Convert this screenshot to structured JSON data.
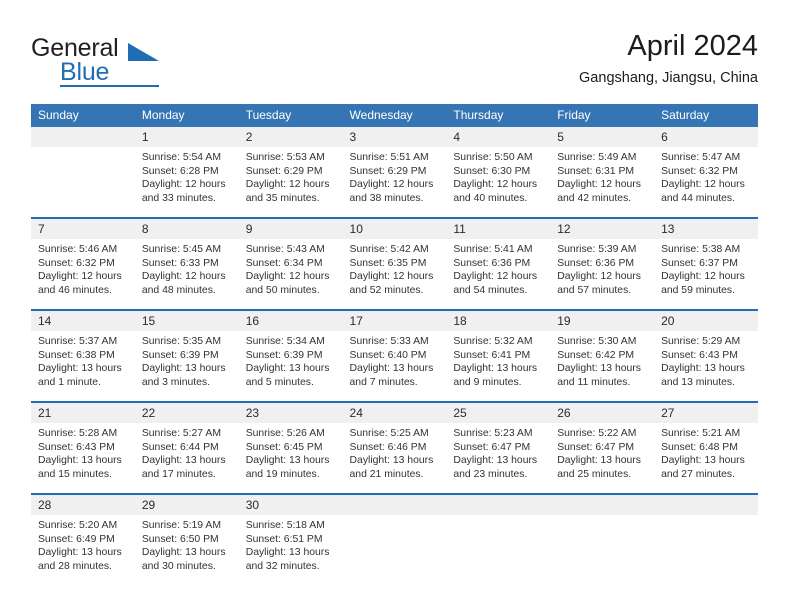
{
  "brand": {
    "name_part1": "General",
    "name_part2": "Blue",
    "logo_icon": "triangle-flag-icon"
  },
  "header": {
    "month_title": "April 2024",
    "location": "Gangshang, Jiangsu, China"
  },
  "colors": {
    "header_blue": "#3575b4",
    "rule_blue": "#1f6eb5",
    "daynum_band": "#f0f0f0",
    "text": "#2b2b2b"
  },
  "calendar": {
    "weekday_headers": [
      "Sunday",
      "Monday",
      "Tuesday",
      "Wednesday",
      "Thursday",
      "Friday",
      "Saturday"
    ],
    "weeks": [
      [
        {
          "day": "",
          "lines": []
        },
        {
          "day": "1",
          "lines": [
            "Sunrise: 5:54 AM",
            "Sunset: 6:28 PM",
            "Daylight: 12 hours",
            "and 33 minutes."
          ]
        },
        {
          "day": "2",
          "lines": [
            "Sunrise: 5:53 AM",
            "Sunset: 6:29 PM",
            "Daylight: 12 hours",
            "and 35 minutes."
          ]
        },
        {
          "day": "3",
          "lines": [
            "Sunrise: 5:51 AM",
            "Sunset: 6:29 PM",
            "Daylight: 12 hours",
            "and 38 minutes."
          ]
        },
        {
          "day": "4",
          "lines": [
            "Sunrise: 5:50 AM",
            "Sunset: 6:30 PM",
            "Daylight: 12 hours",
            "and 40 minutes."
          ]
        },
        {
          "day": "5",
          "lines": [
            "Sunrise: 5:49 AM",
            "Sunset: 6:31 PM",
            "Daylight: 12 hours",
            "and 42 minutes."
          ]
        },
        {
          "day": "6",
          "lines": [
            "Sunrise: 5:47 AM",
            "Sunset: 6:32 PM",
            "Daylight: 12 hours",
            "and 44 minutes."
          ]
        }
      ],
      [
        {
          "day": "7",
          "lines": [
            "Sunrise: 5:46 AM",
            "Sunset: 6:32 PM",
            "Daylight: 12 hours",
            "and 46 minutes."
          ]
        },
        {
          "day": "8",
          "lines": [
            "Sunrise: 5:45 AM",
            "Sunset: 6:33 PM",
            "Daylight: 12 hours",
            "and 48 minutes."
          ]
        },
        {
          "day": "9",
          "lines": [
            "Sunrise: 5:43 AM",
            "Sunset: 6:34 PM",
            "Daylight: 12 hours",
            "and 50 minutes."
          ]
        },
        {
          "day": "10",
          "lines": [
            "Sunrise: 5:42 AM",
            "Sunset: 6:35 PM",
            "Daylight: 12 hours",
            "and 52 minutes."
          ]
        },
        {
          "day": "11",
          "lines": [
            "Sunrise: 5:41 AM",
            "Sunset: 6:36 PM",
            "Daylight: 12 hours",
            "and 54 minutes."
          ]
        },
        {
          "day": "12",
          "lines": [
            "Sunrise: 5:39 AM",
            "Sunset: 6:36 PM",
            "Daylight: 12 hours",
            "and 57 minutes."
          ]
        },
        {
          "day": "13",
          "lines": [
            "Sunrise: 5:38 AM",
            "Sunset: 6:37 PM",
            "Daylight: 12 hours",
            "and 59 minutes."
          ]
        }
      ],
      [
        {
          "day": "14",
          "lines": [
            "Sunrise: 5:37 AM",
            "Sunset: 6:38 PM",
            "Daylight: 13 hours",
            "and 1 minute."
          ]
        },
        {
          "day": "15",
          "lines": [
            "Sunrise: 5:35 AM",
            "Sunset: 6:39 PM",
            "Daylight: 13 hours",
            "and 3 minutes."
          ]
        },
        {
          "day": "16",
          "lines": [
            "Sunrise: 5:34 AM",
            "Sunset: 6:39 PM",
            "Daylight: 13 hours",
            "and 5 minutes."
          ]
        },
        {
          "day": "17",
          "lines": [
            "Sunrise: 5:33 AM",
            "Sunset: 6:40 PM",
            "Daylight: 13 hours",
            "and 7 minutes."
          ]
        },
        {
          "day": "18",
          "lines": [
            "Sunrise: 5:32 AM",
            "Sunset: 6:41 PM",
            "Daylight: 13 hours",
            "and 9 minutes."
          ]
        },
        {
          "day": "19",
          "lines": [
            "Sunrise: 5:30 AM",
            "Sunset: 6:42 PM",
            "Daylight: 13 hours",
            "and 11 minutes."
          ]
        },
        {
          "day": "20",
          "lines": [
            "Sunrise: 5:29 AM",
            "Sunset: 6:43 PM",
            "Daylight: 13 hours",
            "and 13 minutes."
          ]
        }
      ],
      [
        {
          "day": "21",
          "lines": [
            "Sunrise: 5:28 AM",
            "Sunset: 6:43 PM",
            "Daylight: 13 hours",
            "and 15 minutes."
          ]
        },
        {
          "day": "22",
          "lines": [
            "Sunrise: 5:27 AM",
            "Sunset: 6:44 PM",
            "Daylight: 13 hours",
            "and 17 minutes."
          ]
        },
        {
          "day": "23",
          "lines": [
            "Sunrise: 5:26 AM",
            "Sunset: 6:45 PM",
            "Daylight: 13 hours",
            "and 19 minutes."
          ]
        },
        {
          "day": "24",
          "lines": [
            "Sunrise: 5:25 AM",
            "Sunset: 6:46 PM",
            "Daylight: 13 hours",
            "and 21 minutes."
          ]
        },
        {
          "day": "25",
          "lines": [
            "Sunrise: 5:23 AM",
            "Sunset: 6:47 PM",
            "Daylight: 13 hours",
            "and 23 minutes."
          ]
        },
        {
          "day": "26",
          "lines": [
            "Sunrise: 5:22 AM",
            "Sunset: 6:47 PM",
            "Daylight: 13 hours",
            "and 25 minutes."
          ]
        },
        {
          "day": "27",
          "lines": [
            "Sunrise: 5:21 AM",
            "Sunset: 6:48 PM",
            "Daylight: 13 hours",
            "and 27 minutes."
          ]
        }
      ],
      [
        {
          "day": "28",
          "lines": [
            "Sunrise: 5:20 AM",
            "Sunset: 6:49 PM",
            "Daylight: 13 hours",
            "and 28 minutes."
          ]
        },
        {
          "day": "29",
          "lines": [
            "Sunrise: 5:19 AM",
            "Sunset: 6:50 PM",
            "Daylight: 13 hours",
            "and 30 minutes."
          ]
        },
        {
          "day": "30",
          "lines": [
            "Sunrise: 5:18 AM",
            "Sunset: 6:51 PM",
            "Daylight: 13 hours",
            "and 32 minutes."
          ]
        },
        {
          "day": "",
          "lines": []
        },
        {
          "day": "",
          "lines": []
        },
        {
          "day": "",
          "lines": []
        },
        {
          "day": "",
          "lines": []
        }
      ]
    ]
  }
}
